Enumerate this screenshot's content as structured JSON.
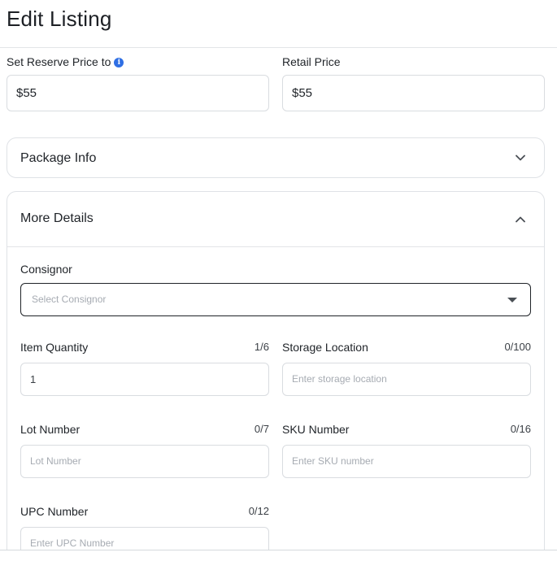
{
  "header": {
    "title": "Edit Listing"
  },
  "pricing": {
    "reserve_label": "Set Reserve Price to",
    "reserve_value": "$55",
    "retail_label": "Retail Price",
    "retail_value": "$55"
  },
  "package_info": {
    "title": "Package Info",
    "expanded": false
  },
  "more_details": {
    "title": "More Details",
    "expanded": true,
    "consignor": {
      "label": "Consignor",
      "placeholder": "Select Consignor"
    },
    "item_quantity": {
      "label": "Item Quantity",
      "counter": "1/6",
      "value": "1"
    },
    "storage_location": {
      "label": "Storage Location",
      "counter": "0/100",
      "placeholder": "Enter storage location"
    },
    "lot_number": {
      "label": "Lot Number",
      "counter": "0/7",
      "placeholder": "Lot Number"
    },
    "sku_number": {
      "label": "SKU Number",
      "counter": "0/16",
      "placeholder": "Enter SKU number"
    },
    "upc_number": {
      "label": "UPC Number",
      "counter": "0/12",
      "placeholder": "Enter UPC Number"
    }
  },
  "colors": {
    "accent_info": "#2f6fe4",
    "border": "#d9dce0",
    "text": "#1f2328",
    "placeholder": "#a6abb2"
  },
  "icons": {
    "info": "info-icon",
    "collapsed": "chevron-down-icon",
    "expanded": "chevron-up-icon",
    "dropdown": "caret-down-icon"
  }
}
